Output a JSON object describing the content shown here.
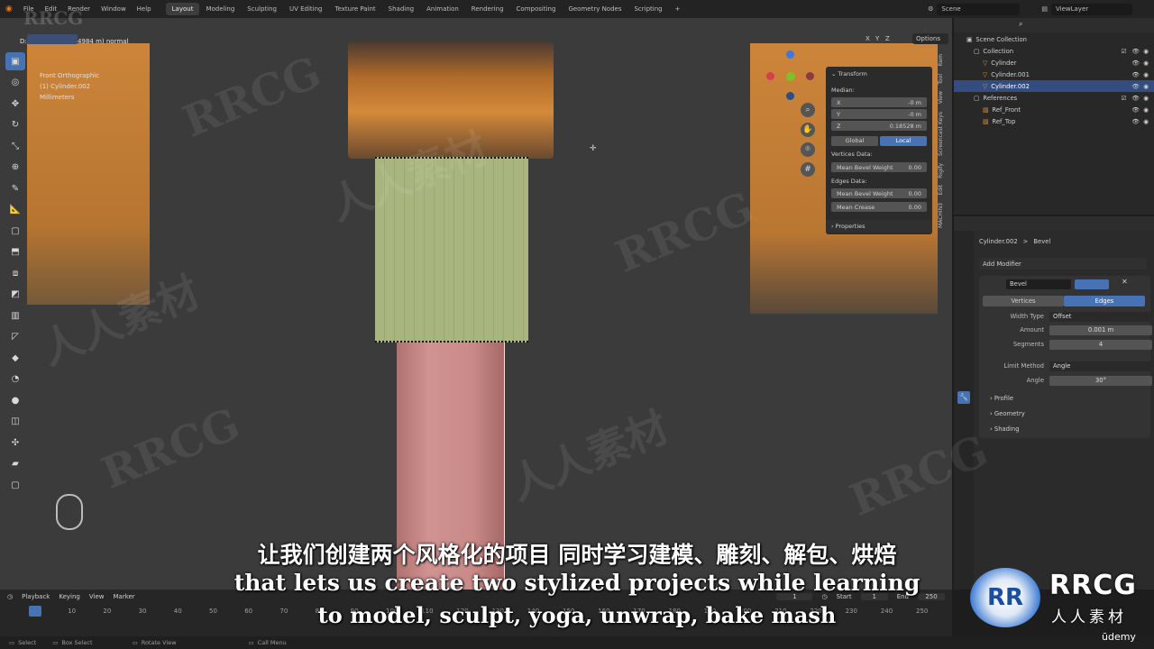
{
  "topbar": {
    "menu": [
      "File",
      "Edit",
      "Render",
      "Window",
      "Help"
    ],
    "workspaces": [
      "Layout",
      "Modeling",
      "Sculpting",
      "UV Editing",
      "Texture Paint",
      "Shading",
      "Animation",
      "Rendering",
      "Compositing",
      "Geometry Nodes",
      "Scripting"
    ],
    "active_workspace": "Layout",
    "scene": "Scene",
    "view_layer": "ViewLayer",
    "plus": "+"
  },
  "viewport": {
    "header_info": "D: 0.04984 m (0.04984 m) normal",
    "view_name": "Front Orthographic",
    "object_info": "(1) Cylinder.002",
    "units": "Millimeters",
    "options_label": "Options",
    "axis_labels": [
      "X",
      "Y",
      "Z"
    ]
  },
  "npanel": {
    "title": "Transform",
    "median_label": "Median:",
    "x_label": "X",
    "x_value": "-0 m",
    "y_label": "Y",
    "y_value": "-0 m",
    "z_label": "Z",
    "z_value": "0.18528 m",
    "global": "Global",
    "local": "Local",
    "vertices_data": "Vertices Data:",
    "mean_bevel_weight_label": "Mean Bevel Weight",
    "mean_bevel_weight_v": "0.00",
    "edges_data": "Edges Data:",
    "mean_bevel_weight_e_label": "Mean Bevel Weight",
    "mean_bevel_weight_e": "0.00",
    "mean_crease_label": "Mean Crease",
    "mean_crease": "0.00",
    "properties_label": "Properties",
    "vtabs": [
      "Item",
      "Tool",
      "View",
      "Screencast Keys",
      "Rigify",
      "Edit",
      "MACHIN3"
    ]
  },
  "outliner": {
    "scene_collection": "Scene Collection",
    "collection": "Collection",
    "items": [
      "Cylinder",
      "Cylinder.001",
      "Cylinder.002"
    ],
    "references": "References",
    "refs": [
      "Ref_Front",
      "Ref_Top"
    ]
  },
  "properties": {
    "breadcrumb_object": "Cylinder.002",
    "breadcrumb_sep": ">",
    "breadcrumb_modifier": "Bevel",
    "add_modifier": "Add Modifier",
    "modifier_name": "Bevel",
    "tab_vertices": "Vertices",
    "tab_edges": "Edges",
    "width_type_label": "Width Type",
    "width_type": "Offset",
    "amount_label": "Amount",
    "amount": "0.001 m",
    "segments_label": "Segments",
    "segments": "4",
    "limit_method_label": "Limit Method",
    "limit_method": "Angle",
    "angle_label": "Angle",
    "angle": "30°",
    "profile": "Profile",
    "geometry": "Geometry",
    "shading": "Shading"
  },
  "timeline": {
    "playback": "Playback",
    "keying": "Keying",
    "view": "View",
    "marker": "Marker",
    "current_frame": "1",
    "start_label": "Start",
    "start": "1",
    "end_label": "End",
    "end": "250",
    "ticks": [
      "1",
      "10",
      "20",
      "30",
      "40",
      "50",
      "60",
      "70",
      "80",
      "90",
      "100",
      "110",
      "120",
      "130",
      "140",
      "150",
      "160",
      "170",
      "180",
      "190",
      "200",
      "210",
      "220",
      "230",
      "240",
      "250"
    ]
  },
  "statusbar": {
    "select": "Select",
    "box_select": "Box Select",
    "rotate_view": "Rotate View",
    "call_menu": "Call Menu"
  },
  "subtitles": {
    "zh": "让我们创建两个风格化的项目 同时学习建模、雕刻、解包、烘焙",
    "en1": "that lets us create two stylized projects while learning",
    "en2": "to model, sculpt, yoga, unwrap, bake mash"
  },
  "watermarks": {
    "rrcg": "RRCG",
    "cn": "人人素材",
    "logo_big": "RRCG",
    "logo_small": "人人素材",
    "udemy": "ūdemy"
  },
  "colors": {
    "accent": "#4772b3",
    "green_cyl": "#a8b57e",
    "pink_cyl": "#c98a88",
    "orange_ref": "#d98b3a",
    "active_row": "#334d80"
  }
}
